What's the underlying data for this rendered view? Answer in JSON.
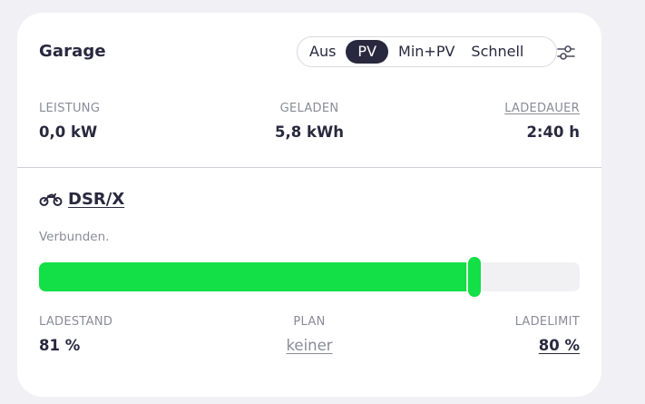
{
  "card": {
    "title": "Garage",
    "modes": [
      "Aus",
      "PV",
      "Min+PV",
      "Schnell"
    ],
    "active_mode": "PV",
    "settings_icon": "sliders-icon"
  },
  "stats": {
    "leistung": {
      "label": "Leistung",
      "value": "0,0 kW"
    },
    "geladen": {
      "label": "Geladen",
      "value": "5,8 kWh"
    },
    "ladedauer": {
      "label": "Ladedauer",
      "value": "2:40 h"
    }
  },
  "vehicle": {
    "icon": "motorcycle-icon",
    "name": "DSR/X",
    "status": "Verbunden."
  },
  "charge": {
    "soc_percent": 81,
    "limit_percent": 80,
    "fill_color": "#13df46",
    "ladestand": {
      "label": "Ladestand",
      "value": "81 %"
    },
    "plan": {
      "label": "Plan",
      "value": "keiner"
    },
    "ladelimit": {
      "label": "Ladelimit",
      "value": "80 %"
    }
  },
  "colors": {
    "text": "#28293e",
    "muted": "#8a8b98",
    "accent_green": "#13df46",
    "background": "#f1f1f5"
  }
}
